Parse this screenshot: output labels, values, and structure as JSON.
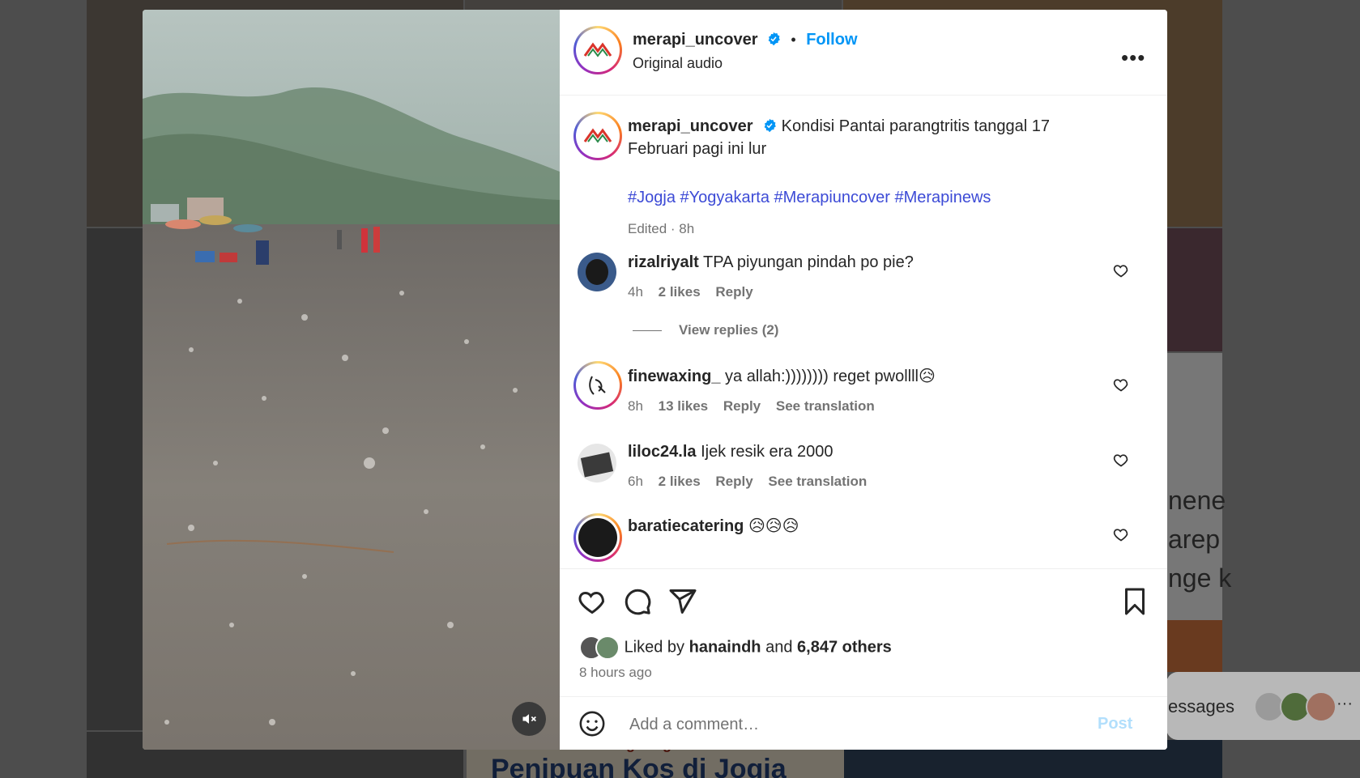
{
  "header": {
    "username": "merapi_uncover",
    "follow_label": "Follow",
    "audio_label": "Original audio",
    "logo_text": "Merapi Uncover"
  },
  "caption": {
    "username": "merapi_uncover",
    "text_line1": "Kondisi Pantai parangtritis tanggal 17",
    "text_line2": "Februari pagi ini lur",
    "hashtags": "#Jogja #Yogyakarta #Merapiuncover #Merapinews",
    "edited": "Edited · 8h"
  },
  "comments": [
    {
      "username": "rizalriyalt",
      "text": "TPA piyungan pindah po pie?",
      "time": "4h",
      "likes": "2 likes",
      "reply": "Reply",
      "translation": ""
    },
    {
      "username": "finewaxing_",
      "text": "ya allah:)))))))) reget pwollll😥",
      "time": "8h",
      "likes": "13 likes",
      "reply": "Reply",
      "translation": "See translation"
    },
    {
      "username": "liloc24.la",
      "text": "Ijek resik era 2000",
      "time": "6h",
      "likes": "2 likes",
      "reply": "Reply",
      "translation": "See translation"
    },
    {
      "username": "baratiecatering",
      "text": "😥😥😥"
    }
  ],
  "view_replies": "View replies (2)",
  "likes": {
    "prefix": "Liked by",
    "user": "hanaindh",
    "and": "and",
    "others": "6,847 others"
  },
  "posted_ago": "8 hours ago",
  "add_comment": {
    "placeholder": "Add a comment…",
    "post_label": "Post"
  },
  "background": {
    "text_lines": [
      "nene",
      "arep",
      "nge k"
    ],
    "messages_label": "essages",
    "banner_line1": "Kronologi Dugaan",
    "banner_line2": "Penipuan Kos di Jogja",
    "more": "···"
  },
  "colors": {
    "accent": "#0095f6",
    "hashtag": "#3d4bd6",
    "verified": "#0095f6",
    "post_disabled": "#b2dffc"
  }
}
